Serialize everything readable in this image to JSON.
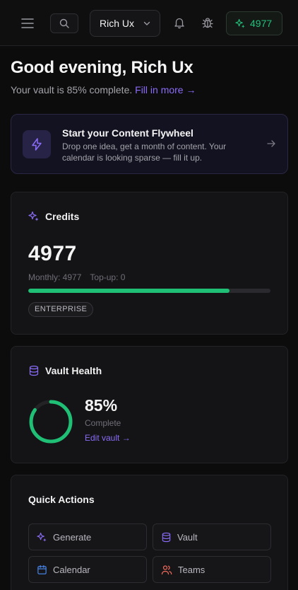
{
  "header": {
    "workspace_name": "Rich Ux",
    "credits_count": "4977"
  },
  "greeting": {
    "title": "Good evening, Rich Ux",
    "subtitle": "Your vault is 85% complete.",
    "fill_link": "Fill in more →"
  },
  "flywheel": {
    "title": "Start your Content Flywheel",
    "description": "Drop one idea, get a month of content. Your calendar is looking sparse — fill it up."
  },
  "credits_card": {
    "title": "Credits",
    "total": "4977",
    "monthly": "Monthly: 4977",
    "topup": "Top-up: 0",
    "progress_fraction": 0.83,
    "plan_badge": "ENTERPRISE"
  },
  "vault_card": {
    "title": "Vault Health",
    "percent": "85%",
    "percent_value": 85,
    "status": "Complete",
    "edit_link": "Edit vault →"
  },
  "quick_actions": {
    "title": "Quick Actions",
    "items": [
      {
        "label": "Generate",
        "icon": "sparkles-icon"
      },
      {
        "label": "Vault",
        "icon": "database-icon"
      },
      {
        "label": "Calendar",
        "icon": "calendar-icon"
      },
      {
        "label": "Teams",
        "icon": "users-icon"
      }
    ]
  },
  "colors": {
    "accent_purple": "#8b6cf7",
    "accent_green": "#1fbf75",
    "teams_red": "#f26b5b",
    "calendar_blue": "#4a8cf5"
  }
}
